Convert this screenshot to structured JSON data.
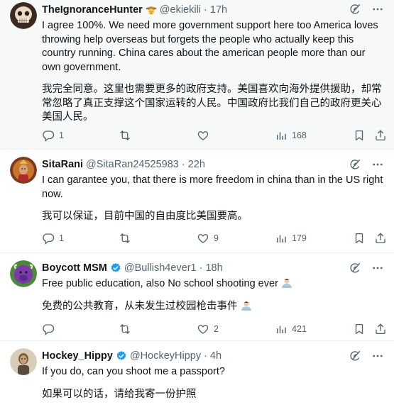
{
  "tweets": [
    {
      "name": "TheIgnoranceHunter",
      "handle": "@ekiekili",
      "time": "17h",
      "text_en": "I agree 100%. We need more government support here too America loves throwing help overseas but forgets the people who actually keep this country running. China cares about the american people more than our own government.",
      "text_zh": "我完全同意。这里也需要更多的政府支持。美国喜欢向海外提供援助，却常常忽略了真正支撑这个国家运转的人民。中国政府比我们自己的政府更关心美国人民。",
      "replies": "1",
      "retweets": "",
      "likes": "",
      "views": "168"
    },
    {
      "name": "SitaRani",
      "handle": "@SitaRan24525983",
      "time": "22h",
      "text_en": "I can garantee you, that there is more freedom in china than in the US right now.",
      "text_zh": "我可以保证，目前中国的自由度比美国要高。",
      "replies": "1",
      "retweets": "",
      "likes": "9",
      "views": "179"
    },
    {
      "name": "Boycott MSM",
      "handle": "@Bullish4ever1",
      "time": "18h",
      "text_en": "Free public education, also No school shooting ever",
      "text_zh": "免费的公共教育，从未发生过校园枪击事件",
      "replies": "",
      "retweets": "",
      "likes": "2",
      "views": "421"
    },
    {
      "name": "Hockey_Hippy",
      "handle": "@HockeyHippy",
      "time": "4h",
      "text_en": "If you do, can you shoot me a passport?",
      "text_zh": "如果可以的话，请给我寄一份护照"
    }
  ],
  "colors": {
    "text": "#0f1419",
    "secondary": "#536471",
    "verified": "#1d9bf0",
    "highlight_bg": "#f7f8f8"
  },
  "icons": [
    "reply-icon",
    "retweet-icon",
    "like-icon",
    "views-icon",
    "bookmark-icon",
    "share-icon",
    "grok-icon",
    "more-icon",
    "verified-badge-icon"
  ]
}
